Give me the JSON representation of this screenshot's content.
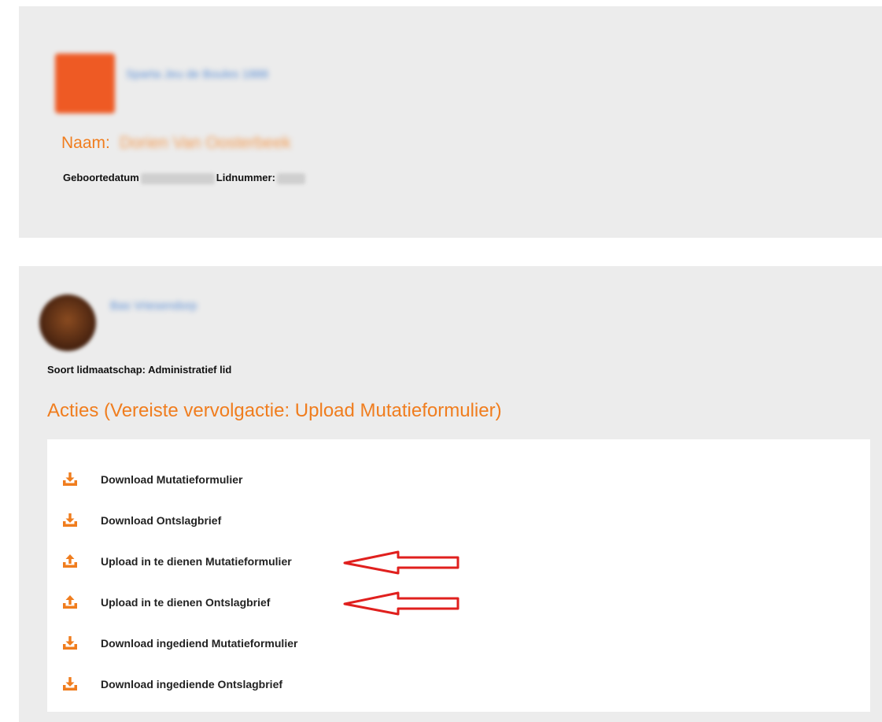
{
  "profile": {
    "club_name": "Sparta Jeu de Boules 1888",
    "naam_label": "Naam:",
    "naam_value": "Dorien Van Oosterbeek",
    "geboortedatum_label": "Geboortedatum",
    "lidnummer_label": "Lidnummer:"
  },
  "membership": {
    "person_name": "Bas Vriesendorp",
    "type_text": "Soort lidmaatschap: Administratief lid"
  },
  "acties": {
    "title": "Acties (Vereiste vervolgactie: Upload Mutatieformulier)",
    "items": [
      {
        "label": "Download Mutatieformulier",
        "icon": "download-icon"
      },
      {
        "label": "Download Ontslagbrief",
        "icon": "download-icon"
      },
      {
        "label": "Upload in te dienen Mutatieformulier",
        "icon": "upload-icon"
      },
      {
        "label": "Upload in te dienen Ontslagbrief",
        "icon": "upload-icon"
      },
      {
        "label": "Download ingediend Mutatieformulier",
        "icon": "download-icon"
      },
      {
        "label": "Download ingediende Ontslagbrief",
        "icon": "download-icon"
      }
    ]
  },
  "colors": {
    "accent": "#f07d1e",
    "panel_background": "#ececec",
    "annotation_arrow": "#e0201e"
  }
}
